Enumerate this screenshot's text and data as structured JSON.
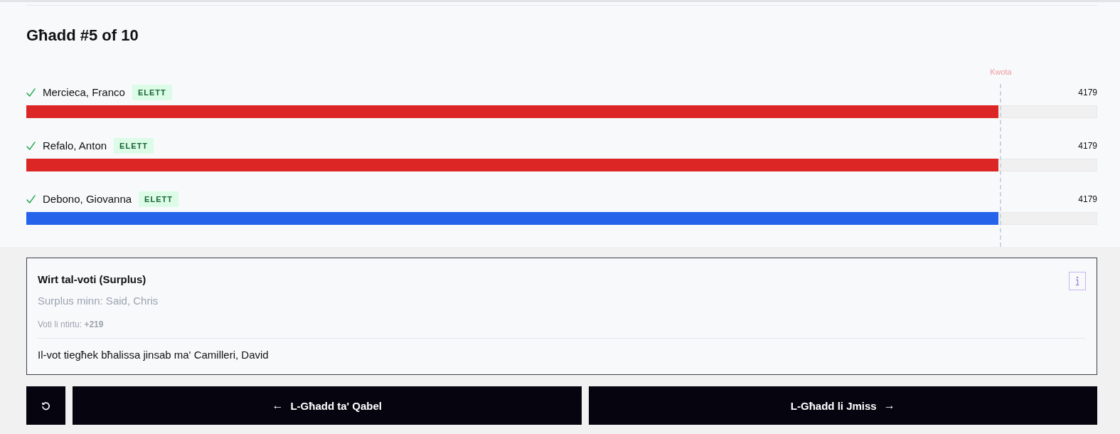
{
  "round": {
    "title": "Għadd #5 of 10"
  },
  "quota": {
    "label": "Kwota",
    "level": 0.91
  },
  "candidates": [
    {
      "name": "Mercieca, Franco",
      "elected": true,
      "badge": "ELETT",
      "votes": "4179",
      "level": 0.909,
      "color": "#dc2626"
    },
    {
      "name": "Refalo, Anton",
      "elected": true,
      "badge": "ELETT",
      "votes": "4179",
      "level": 0.909,
      "color": "#dc2626"
    },
    {
      "name": "Debono, Giovanna",
      "elected": true,
      "badge": "ELETT",
      "votes": "4179",
      "level": 0.909,
      "color": "#2563eb"
    }
  ],
  "transfer": {
    "title": "Wirt tal-voti (Surplus)",
    "source": "Surplus minn: Said, Chris",
    "received": "Voti li ntirtu: **+219**",
    "status": "Il-vot tiegħek bħalissa jinsab ma' Camilleri, David"
  },
  "navigation": {
    "previous": {
      "arrow": "←",
      "label": "L-Għadd ta' Qabel"
    },
    "next": {
      "label": "L-Għadd li Jmiss",
      "arrow": "→"
    }
  }
}
